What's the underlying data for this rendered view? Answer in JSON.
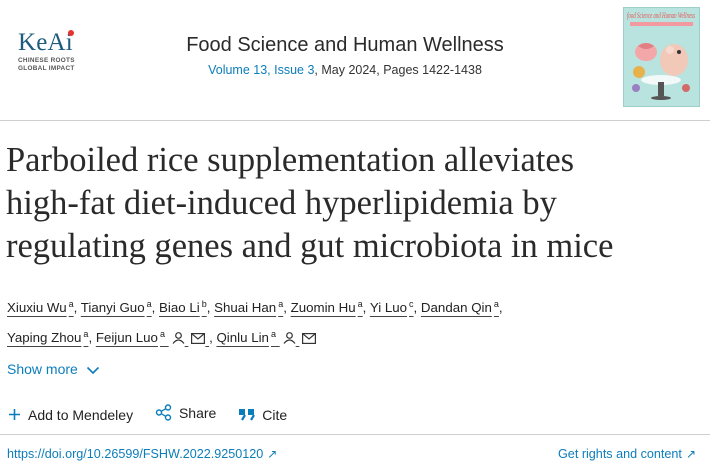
{
  "publisher": {
    "logo_text": "KeAi",
    "tagline_1": "CHINESE ROOTS",
    "tagline_2": "GLOBAL IMPACT"
  },
  "journal": {
    "title": "Food Science and Human Wellness",
    "volume_issue": "Volume 13, Issue 3",
    "date_pages": ", May 2024, Pages 1422-1438",
    "cover_text": "food Science and Human Wellness"
  },
  "article": {
    "title_line1": "Parboiled rice supplementation alleviates",
    "title_line2": "high-fat diet-induced hyperlipidemia by",
    "title_line3": "regulating genes and gut microbiota in mice"
  },
  "authors": [
    {
      "name": "Xiuxiu Wu",
      "aff": "a"
    },
    {
      "name": "Tianyi Guo",
      "aff": "a"
    },
    {
      "name": "Biao Li",
      "aff": "b"
    },
    {
      "name": "Shuai Han",
      "aff": "a"
    },
    {
      "name": "Zuomin Hu",
      "aff": "a"
    },
    {
      "name": "Yi Luo",
      "aff": "c"
    },
    {
      "name": "Dandan Qin",
      "aff": "a"
    },
    {
      "name": "Yaping Zhou",
      "aff": "a"
    },
    {
      "name": "Feijun Luo",
      "aff": "a"
    },
    {
      "name": "Qinlu Lin",
      "aff": "a"
    }
  ],
  "controls": {
    "show_more": "Show more",
    "add_mendeley": "Add to Mendeley",
    "share": "Share",
    "cite": "Cite"
  },
  "footer": {
    "doi": "https://doi.org/10.26599/FSHW.2022.9250120",
    "rights": "Get rights and content"
  },
  "colors": {
    "link": "#0c7dbb",
    "logo": "#1e5c7e",
    "logo_dot": "#e3342f",
    "cover_bg": "#b9e3df"
  }
}
